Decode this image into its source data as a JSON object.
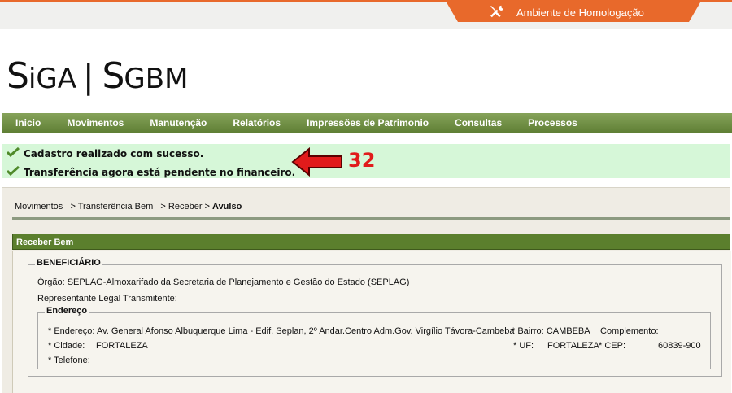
{
  "environment": {
    "label": "Ambiente de Homologação",
    "icon": "wrench-screwdriver-icon",
    "color": "#e8692b"
  },
  "logo": {
    "text_a": "S",
    "text_b": "iGA",
    "separator": "|",
    "text_c": "S",
    "text_d": "GBM"
  },
  "nav": {
    "items": [
      "Inicio",
      "Movimentos",
      "Manutenção",
      "Relatórios",
      "Impressões de Patrimonio",
      "Consultas",
      "Processos"
    ]
  },
  "messages": [
    {
      "text": "Cadastro realizado com sucesso.",
      "icon": "check-icon"
    },
    {
      "text": "Transferência agora está pendente no financeiro.",
      "icon": "check-icon"
    }
  ],
  "annotation": {
    "number": "32",
    "icon": "red-arrow-left-icon"
  },
  "breadcrumb": {
    "path": "Movimentos   > Transferência Bem   > Receber > ",
    "current": "Avulso"
  },
  "panel": {
    "title": "Receber Bem"
  },
  "beneficiario": {
    "legend": "BENEFICIÁRIO",
    "orgao_label": "Órgão:",
    "orgao_value": "SEPLAG-Almoxarifado da Secretaria de Planejamento e Gestão do Estado (SEPLAG)",
    "representante_label": "Representante Legal Transmitente:",
    "endereco": {
      "legend": "Endereço",
      "endereco_label": "* Endereço:",
      "endereco_value": "Av. General Afonso Albuquerque Lima - Edif. Seplan, 2º Andar.Centro Adm.Gov. Virgílio Távora-Cambeba",
      "bairro_label": "* Bairro:",
      "bairro_value": "CAMBEBA",
      "complemento_label": "Complemento:",
      "cidade_label": "* Cidade:",
      "cidade_value": "FORTALEZA",
      "uf_label": "* UF:",
      "uf_value": "FORTALEZA",
      "cep_label": "* CEP:",
      "cep_value": "60839-900",
      "telefone_label": "* Telefone:"
    }
  }
}
